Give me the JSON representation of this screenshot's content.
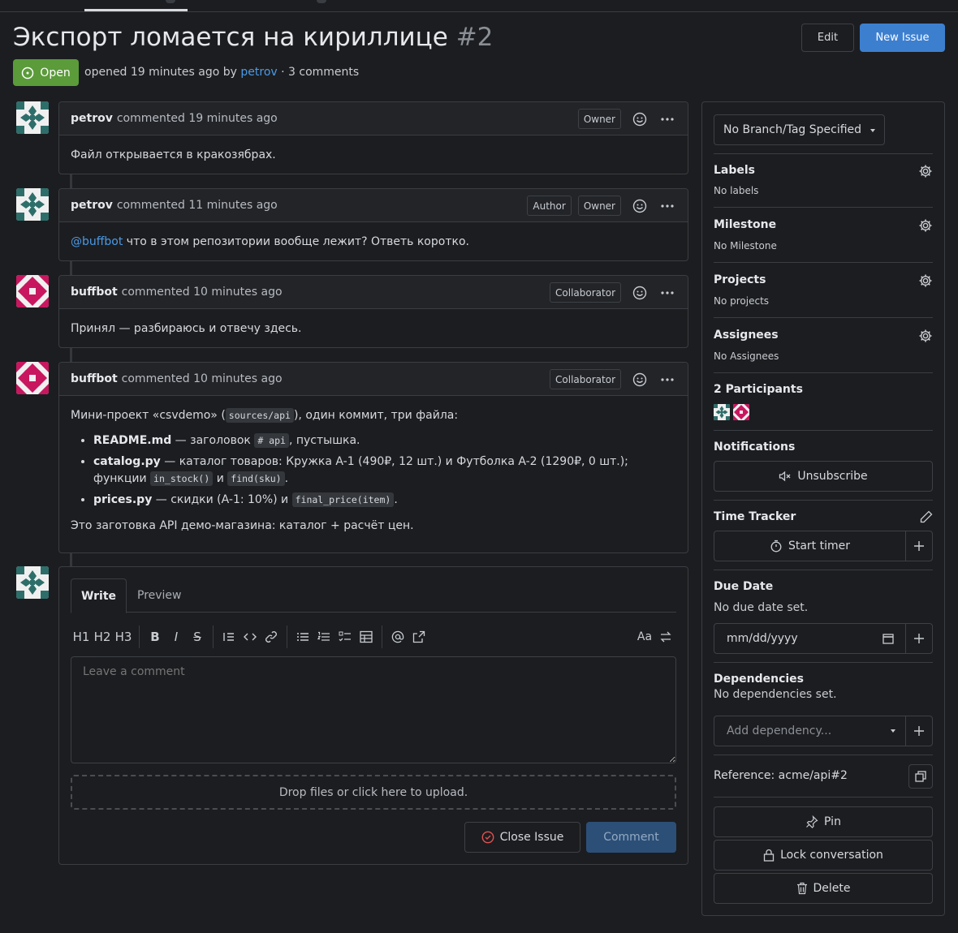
{
  "issue": {
    "title": "Экспорт ломается на кириллице",
    "number": "#2",
    "status": "Open",
    "meta_prefix": "opened 19 minutes ago by",
    "meta_author": "petrov",
    "meta_suffix": "· 3 comments"
  },
  "header": {
    "edit_label": "Edit",
    "new_issue_label": "New Issue"
  },
  "comments": [
    {
      "author": "petrov",
      "action": "commented 19 minutes ago",
      "roles": [
        "Owner"
      ],
      "body": "Файл открывается в кракозябрах."
    },
    {
      "author": "petrov",
      "action": "commented 11 minutes ago",
      "roles": [
        "Author",
        "Owner"
      ],
      "mention": "@buffbot",
      "body": " что в этом репозитории вообще лежит? Ответь коротко."
    },
    {
      "author": "buffbot",
      "action": "commented 10 minutes ago",
      "roles": [
        "Collaborator"
      ],
      "body": "Принял — разбираюсь и отвечу здесь."
    },
    {
      "author": "buffbot",
      "action": "commented 10 minutes ago",
      "roles": [
        "Collaborator"
      ],
      "intro_a": "Мини-проект «csvdemo» (",
      "intro_code": "sources/api",
      "intro_b": "), один коммит, три файла:",
      "items": [
        {
          "name": "README.md",
          "text_a": " — заголовок ",
          "code1": "# api",
          "text_b": ", пустышка."
        },
        {
          "name": "catalog.py",
          "text_a": " — каталог товаров: Кружка A-1 (490₽, 12 шт.) и Футболка A-2 (1290₽, 0 шт.); функции ",
          "code1": "in_stock()",
          "text_b": " и ",
          "code2": "find(sku)",
          "text_c": "."
        },
        {
          "name": "prices.py",
          "text_a": " — скидки (A-1: 10%) и ",
          "code1": "final_price(item)",
          "text_b": "."
        }
      ],
      "outro": "Это заготовка API демо-магазина: каталог + расчёт цен."
    }
  ],
  "editor": {
    "tab_write": "Write",
    "tab_preview": "Preview",
    "toolbar": [
      "H1",
      "H2",
      "H3",
      "B",
      "I",
      "S",
      "Aa"
    ],
    "placeholder": "Leave a comment",
    "dropzone": "Drop files or click here to upload.",
    "close_issue": "Close Issue",
    "comment": "Comment"
  },
  "sidebar": {
    "branch": "No Branch/Tag Specified",
    "labels_title": "Labels",
    "labels_value": "No labels",
    "milestone_title": "Milestone",
    "milestone_value": "No Milestone",
    "projects_title": "Projects",
    "projects_value": "No projects",
    "assignees_title": "Assignees",
    "assignees_value": "No Assignees",
    "participants_title": "2 Participants",
    "notifications_title": "Notifications",
    "unsubscribe": "Unsubscribe",
    "time_tracker_title": "Time Tracker",
    "start_timer": "Start timer",
    "due_date_title": "Due Date",
    "due_date_value": "No due date set.",
    "date_placeholder": "mm/dd/yyyy",
    "dependencies_title": "Dependencies",
    "dependencies_value": "No dependencies set.",
    "add_dependency": "Add dependency...",
    "reference": "Reference: acme/api#2",
    "pin": "Pin",
    "lock": "Lock conversation",
    "delete": "Delete"
  },
  "colors": {
    "accent": "#3d7fcf",
    "open": "#5b9b3a",
    "link": "#4a9ae8",
    "bg": "#1c1d20"
  }
}
